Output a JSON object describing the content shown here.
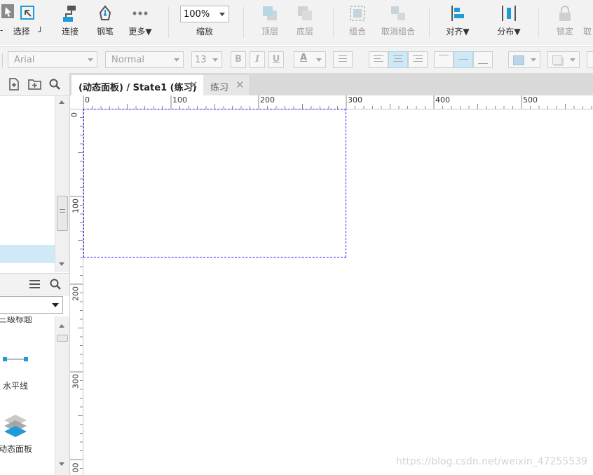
{
  "toolbar": {
    "select_label": "选择",
    "connect_label": "连接",
    "pen_label": "钢笔",
    "more_label": "更多▼",
    "zoom_value": "100%",
    "zoom_label": "缩放",
    "top_layer_label": "顶层",
    "bottom_layer_label": "底层",
    "group_label": "组合",
    "ungroup_label": "取消组合",
    "align_label": "对齐▼",
    "distribute_label": "分布▼",
    "lock_label": "锁定",
    "cut_label": "取"
  },
  "format_bar": {
    "font_family": "Arial",
    "font_style": "Normal",
    "font_size": "13",
    "bold": "B",
    "italic": "I",
    "underline": "U",
    "font_color": "A"
  },
  "tabs": [
    {
      "label": "(动态面板) / State1 (练习)",
      "active": true
    },
    {
      "label": "练习",
      "active": false
    }
  ],
  "ruler": {
    "h_labels": [
      "0",
      "100",
      "200",
      "300",
      "400",
      "500"
    ],
    "v_labels": [
      "0",
      "100",
      "200",
      "300",
      "00"
    ]
  },
  "library": {
    "partial_item": "三级标题",
    "items": [
      {
        "label": "水平线",
        "icon": "horizontal-line-icon"
      },
      {
        "label": "动态面板",
        "icon": "dynamic-panel-icon"
      }
    ]
  },
  "watermark": "https://blog.csdn.net/weixin_47255539",
  "colors": {
    "accent": "#1f9bd7",
    "selection_border": "#1a1aff",
    "selected_row": "#cfe9f7"
  }
}
